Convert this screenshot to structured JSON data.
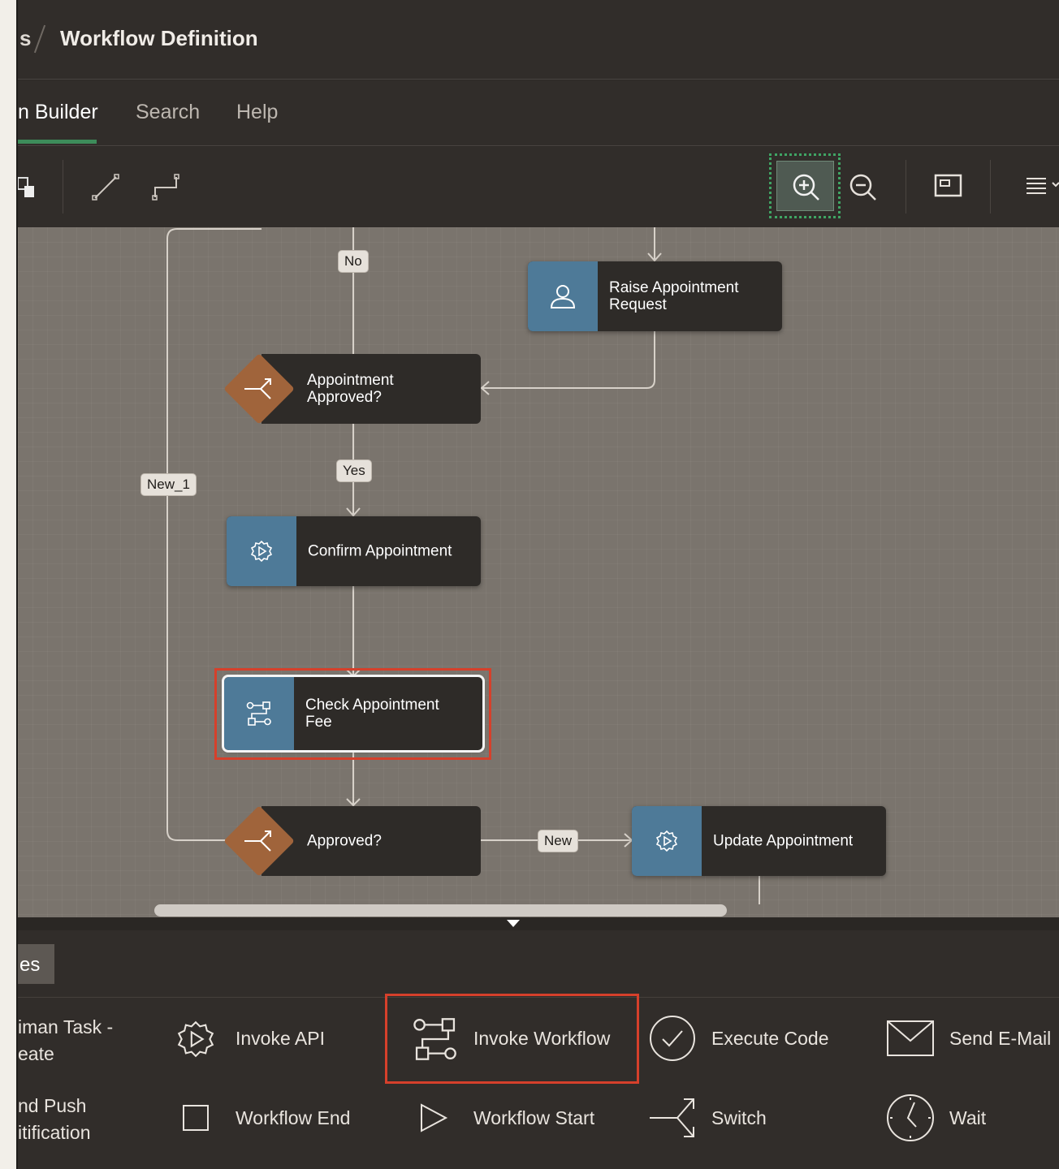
{
  "header": {
    "breadcrumb_prev": "s",
    "title": "Workflow Definition"
  },
  "tabs": [
    {
      "label": "n Builder",
      "active": true
    },
    {
      "label": "Search",
      "active": false
    },
    {
      "label": "Help",
      "active": false
    }
  ],
  "toolbar": {
    "icons": [
      "add-shape-icon",
      "straight-connector-icon",
      "elbow-connector-icon",
      "zoom-in-icon",
      "zoom-out-icon",
      "fit-icon",
      "menu-icon"
    ]
  },
  "diagram": {
    "nodes": {
      "raise": "Raise Appointment Request",
      "raise_l1": "Raise Appointment",
      "raise_l2": "Request",
      "approved_q_l1": "Appointment",
      "approved_q_l2": "Approved?",
      "confirm": "Confirm Appointment",
      "check_l1": "Check Appointment",
      "check_l2": "Fee",
      "approved": "Approved?",
      "update": "Update Appointment"
    },
    "edge_labels": {
      "no": "No",
      "yes": "Yes",
      "new1": "New_1",
      "new": "New"
    }
  },
  "palette": {
    "tab_label": "es",
    "items": {
      "human_task_l1": "iman Task -",
      "human_task_l2": "eate",
      "invoke_api": "Invoke API",
      "invoke_workflow": "Invoke Workflow",
      "execute_code": "Execute Code",
      "send_email": "Send E-Mail",
      "push_l1": "nd Push",
      "push_l2": "itification",
      "workflow_end": "Workflow End",
      "workflow_start": "Workflow Start",
      "switch": "Switch",
      "wait": "Wait"
    }
  },
  "colors": {
    "accent_green": "#3d8c5a",
    "highlight_red": "#d6402b",
    "task_blue": "#4e7a98",
    "switch_orange": "#a0643b"
  }
}
